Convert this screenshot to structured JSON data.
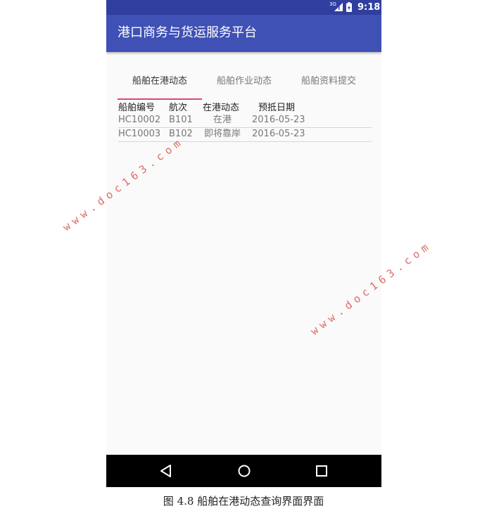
{
  "status_bar": {
    "network": "3G",
    "time": "9:18",
    "icons": [
      "signal-icon",
      "battery-icon"
    ]
  },
  "app_bar": {
    "title": "港口商务与货运服务平台"
  },
  "tabs": [
    {
      "label": "船舶在港动态",
      "active": true
    },
    {
      "label": "船舶作业动态",
      "active": false
    },
    {
      "label": "船舶资料提交",
      "active": false
    }
  ],
  "table": {
    "headers": [
      "船舶编号",
      "航次",
      "在港动态",
      "预抵日期"
    ],
    "rows": [
      [
        "HC10002",
        "B101",
        "在港",
        "2016-05-23"
      ],
      [
        "HC10003",
        "B102",
        "即将靠岸",
        "2016-05-23"
      ]
    ]
  },
  "nav_bar": {
    "icons": [
      "back-icon",
      "home-icon",
      "recent-apps-icon"
    ]
  },
  "watermarks": [
    "www.doc163.com",
    "www.doc163.com"
  ],
  "caption": "图 4.8 船舶在港动态查询界面界面",
  "colors": {
    "status_bar": "#303f9f",
    "app_bar": "#3f51b5",
    "tab_indicator": "#e0437a",
    "watermark": "#d9534f"
  }
}
